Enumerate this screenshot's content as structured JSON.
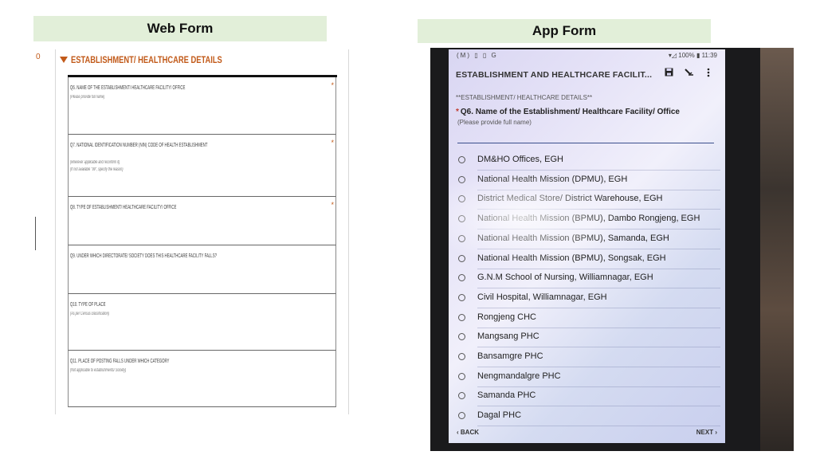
{
  "headers": {
    "web": "Web Form",
    "app": "App Form"
  },
  "web_form": {
    "marker": "0",
    "section_title": "ESTABLISHMENT/ HEALTHCARE DETAILS",
    "questions": [
      {
        "title": "Q6. NAME OF THE ESTABLISHMENT/ HEALTHCARE FACILITY/ OFFICE",
        "sub": "(Please provide full name)",
        "sub2": "",
        "required": "*"
      },
      {
        "title": "Q7. NATIONAL IDENTIFICATION NUMBER (NIN) CODE OF HEALTH ESTABLISHMENT",
        "sub": "(wherever applicable and reconfirm it)",
        "sub2": "(If not available \"99\", specify the reason)",
        "required": "*"
      },
      {
        "title": "Q8. TYPE OF ESTABLISHMENT/ HEALTHCARE FACILITY/ OFFICE",
        "sub": "",
        "sub2": "",
        "required": "*"
      },
      {
        "title": "Q9. UNDER WHICH DIRECTORATE/ SOCIETY DOES THIS HEALTHCARE FACILITY FALLS?",
        "sub": "",
        "sub2": "",
        "required": ""
      },
      {
        "title": "Q10. TYPE OF PLACE",
        "sub": "(As per Census classification)",
        "sub2": "",
        "required": ""
      },
      {
        "title": "Q11. PLACE OF POSTING FALLS UNDER WHICH CATEGORY",
        "sub": "(Not applicable to establishments/ Society)",
        "sub2": "",
        "required": ""
      }
    ]
  },
  "app_form": {
    "status_left": "(M) ▯ ▯ G",
    "status_right": "▾◿ 100% ▮ 11:39",
    "title": "ESTABLISHMENT AND HEALTHCARE FACILIT...",
    "section_label": "**ESTABLISHMENT/ HEALTHCARE DETAILS**",
    "question_star": "*",
    "question": "Q6. Name of the Establishment/ Healthcare Facility/ Office",
    "question_sub": "(Please provide full name)",
    "options": [
      "DM&HO Offices, EGH",
      "National Health Mission (DPMU), EGH",
      "District Medical Store/ District Warehouse, EGH",
      "National Health Mission (BPMU), Dambo Rongjeng, EGH",
      "National Health Mission (BPMU), Samanda, EGH",
      "National Health Mission (BPMU), Songsak, EGH",
      "G.N.M School of Nursing, Williamnagar, EGH",
      "Civil Hospital, Williamnagar, EGH",
      "Rongjeng CHC",
      "Mangsang PHC",
      "Bansamgre PHC",
      "Nengmandalgre PHC",
      "Samanda PHC",
      "Dagal PHC"
    ],
    "back": "BACK",
    "next": "NEXT",
    "icons": {
      "save": "save-icon",
      "sign": "signature-icon",
      "menu": "more-vertical-icon"
    }
  }
}
